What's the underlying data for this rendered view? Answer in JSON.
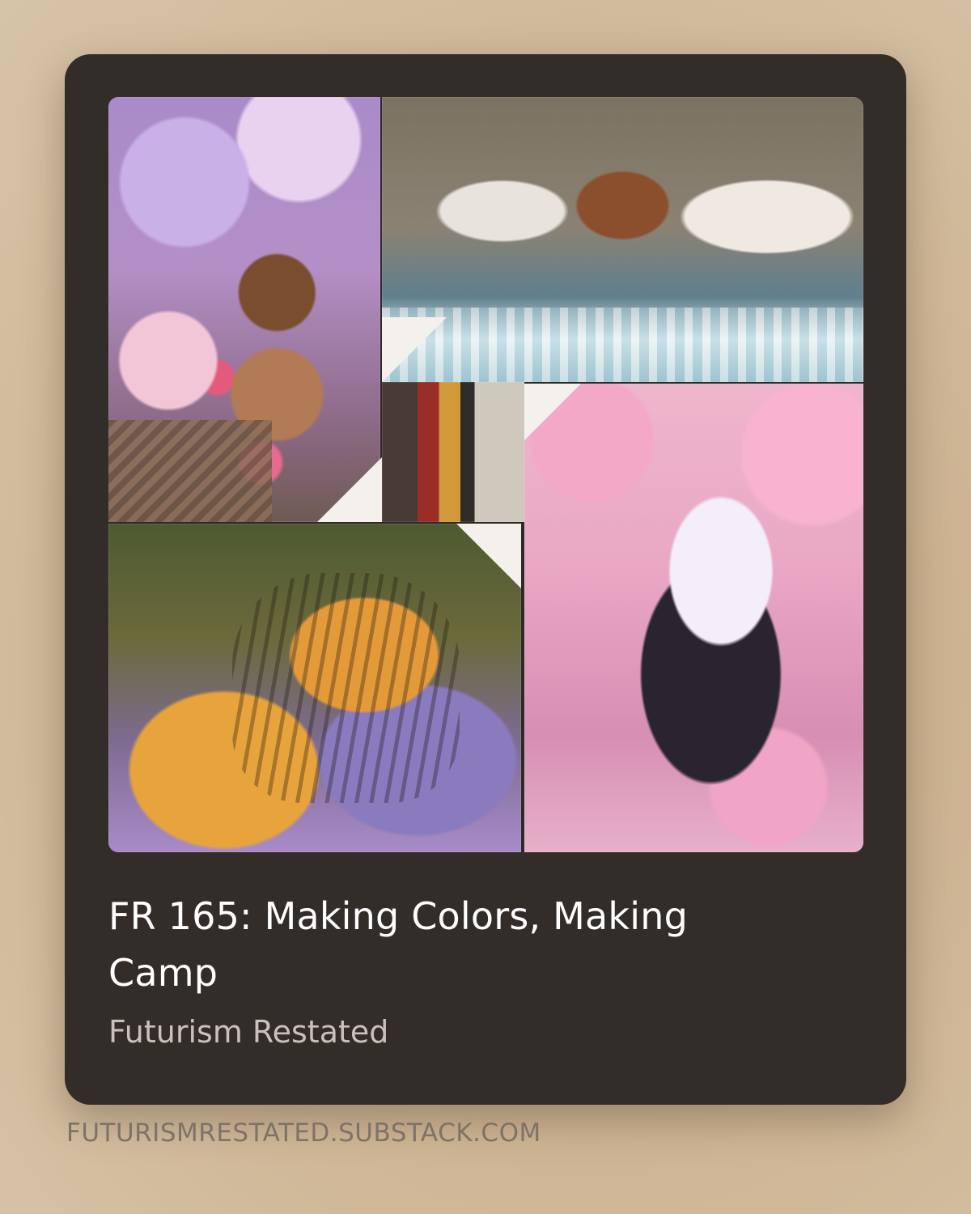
{
  "card": {
    "title": "FR 165: Making Colors, Making Camp",
    "publication": "Futurism Restated"
  },
  "link": {
    "domain": "FUTURISMRESTATED.SUBSTACK.COM"
  }
}
